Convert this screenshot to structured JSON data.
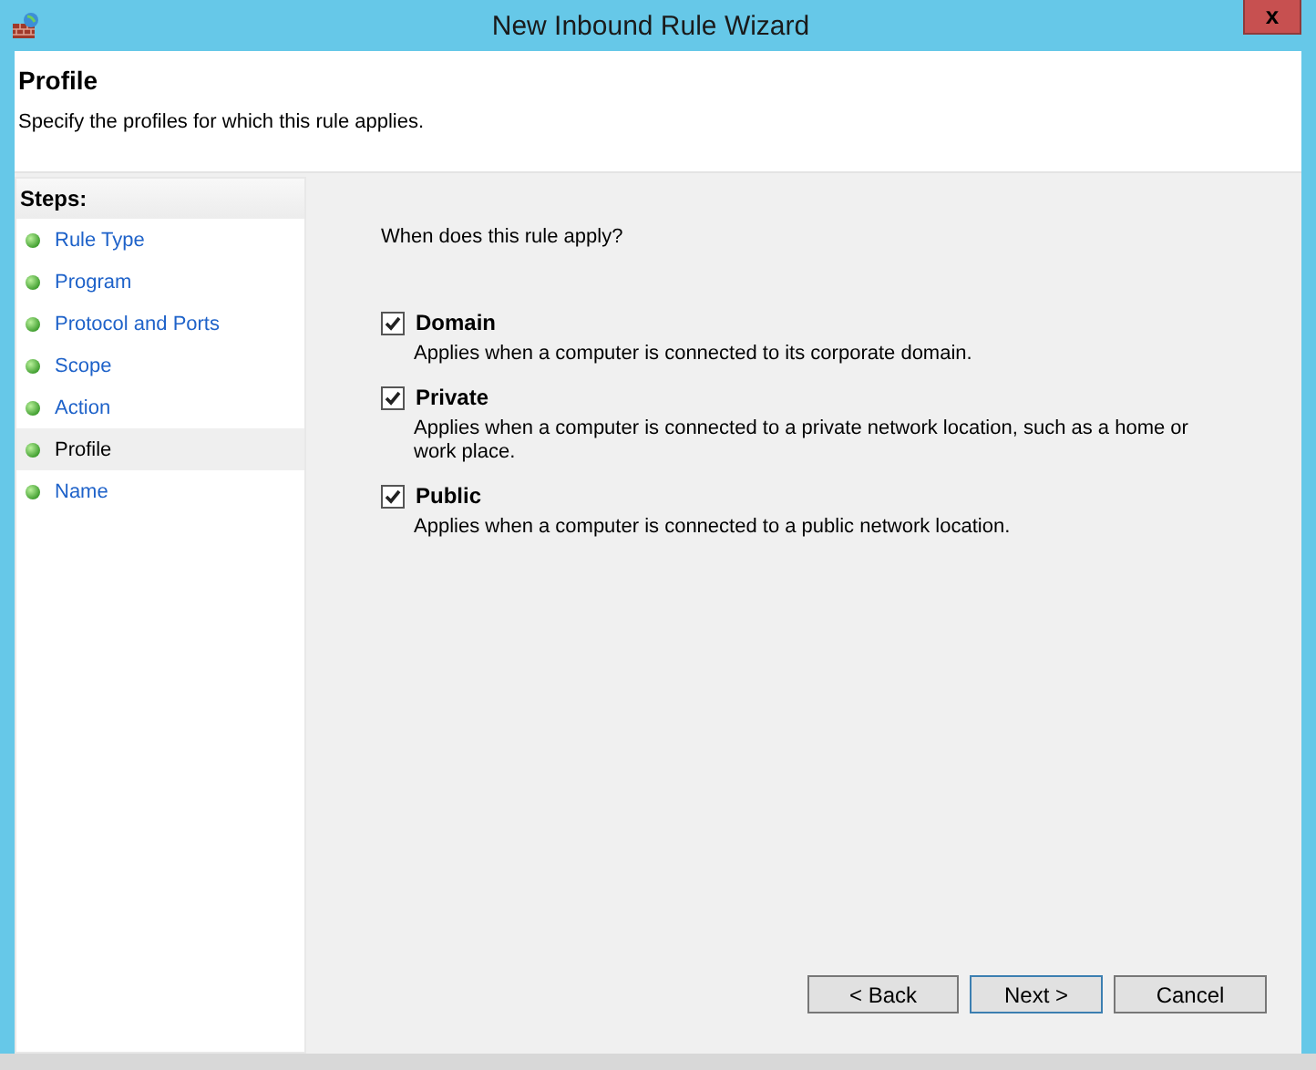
{
  "window": {
    "title": "New Inbound Rule Wizard",
    "close": "x"
  },
  "header": {
    "title": "Profile",
    "description": "Specify the profiles for which this rule applies."
  },
  "steps": {
    "heading": "Steps:",
    "items": [
      {
        "label": "Rule Type",
        "selected": false
      },
      {
        "label": "Program",
        "selected": false
      },
      {
        "label": "Protocol and Ports",
        "selected": false
      },
      {
        "label": "Scope",
        "selected": false
      },
      {
        "label": "Action",
        "selected": false
      },
      {
        "label": "Profile",
        "selected": true
      },
      {
        "label": "Name",
        "selected": false
      }
    ]
  },
  "question": "When does this rule apply?",
  "profiles": [
    {
      "label": "Domain",
      "checked": true,
      "description": "Applies when a computer is connected to its corporate domain."
    },
    {
      "label": "Private",
      "checked": true,
      "description": "Applies when a computer is connected to a private network location, such as a home or work place."
    },
    {
      "label": "Public",
      "checked": true,
      "description": "Applies when a computer is connected to a public network location."
    }
  ],
  "buttons": [
    {
      "label": "< Back",
      "kind": "normal"
    },
    {
      "label": "Next >",
      "kind": "default"
    },
    {
      "label": "Cancel",
      "kind": "normal"
    }
  ]
}
